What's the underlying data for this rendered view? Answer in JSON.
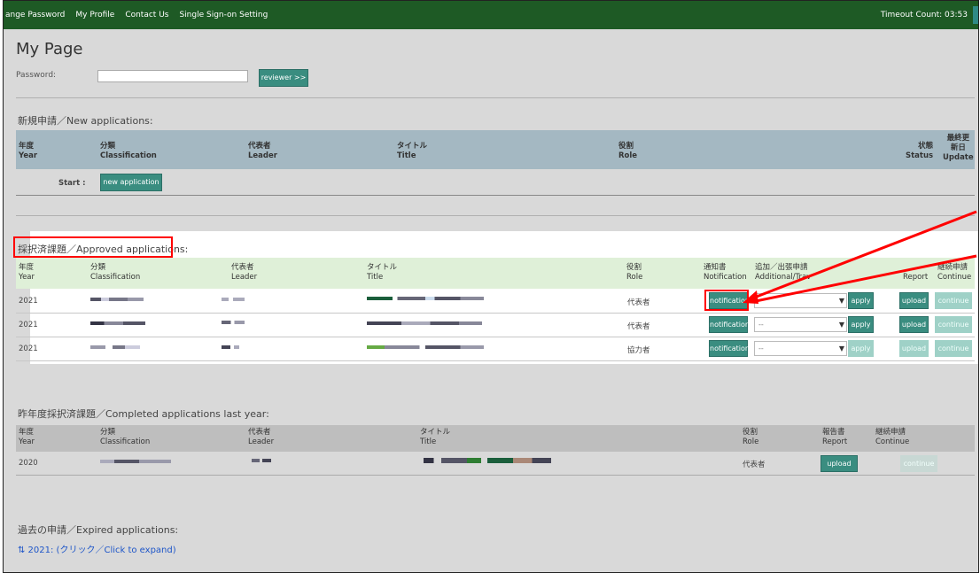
{
  "nav": {
    "items": [
      "ange Password",
      "My Profile",
      "Contact Us",
      "Single Sign-on Setting"
    ],
    "timeout": "Timeout Count: 03:53"
  },
  "page": {
    "title": "My Page",
    "password_label": "Password:",
    "reviewer_button": "reviewer >>"
  },
  "new_apps": {
    "title": "新規申請／New applications:",
    "headers": {
      "year_jp": "年度",
      "year_en": "Year",
      "class_jp": "分類",
      "class_en": "Classification",
      "leader_jp": "代表者",
      "leader_en": "Leader",
      "title_jp": "タイトル",
      "title_en": "Title",
      "role_jp": "役割",
      "role_en": "Role",
      "status_jp": "状態",
      "status_en": "Status",
      "update_jp1": "最終更",
      "update_jp2": "新日",
      "update_en": "Update"
    },
    "start_label": "Start :",
    "new_button": "new application"
  },
  "approved": {
    "title": "採択済課題／Approved applications:",
    "headers": {
      "year_jp": "年度",
      "year_en": "Year",
      "class_jp": "分類",
      "class_en": "Classification",
      "leader_jp": "代表者",
      "leader_en": "Leader",
      "title_jp": "タイトル",
      "title_en": "Title",
      "role_jp": "役割",
      "role_en": "Role",
      "notif_jp": "通知書",
      "notif_en": "Notification",
      "add_jp": "追加／出張申請",
      "add_en": "Additional/Trav",
      "report_en": "Report",
      "cont_jp": "継続申請",
      "cont_en": "Continue"
    },
    "rows": [
      {
        "year": "2021",
        "role": "代表者",
        "notification": "notification",
        "select": "",
        "apply": "apply",
        "upload": "upload",
        "continue": "continue"
      },
      {
        "year": "2021",
        "role": "代表者",
        "notification": "notification",
        "select": "--",
        "apply": "apply",
        "upload": "upload",
        "continue": "continue"
      },
      {
        "year": "2021",
        "role": "協力者",
        "notification": "notification",
        "select": "--",
        "apply": "apply",
        "upload": "upload",
        "continue": "continue"
      }
    ]
  },
  "completed": {
    "title": "昨年度採択済課題／Completed applications last year:",
    "headers": {
      "year_jp": "年度",
      "year_en": "Year",
      "class_jp": "分類",
      "class_en": "Classification",
      "leader_jp": "代表者",
      "leader_en": "Leader",
      "title_jp": "タイトル",
      "title_en": "Title",
      "role_jp": "役割",
      "role_en": "Role",
      "report_jp": "報告書",
      "report_en": "Report",
      "cont_jp": "継続申請",
      "cont_en": "Continue"
    },
    "row": {
      "year": "2020",
      "role": "代表者",
      "upload": "upload",
      "continue": "continue"
    }
  },
  "expired": {
    "title": "過去の申請／Expired applications:",
    "link": "⇅ 2021: (クリック／Click to expand)"
  },
  "colors": {
    "topbar": "#1e5a25",
    "button": "#3a8d80",
    "highlight": "#ff0000"
  }
}
